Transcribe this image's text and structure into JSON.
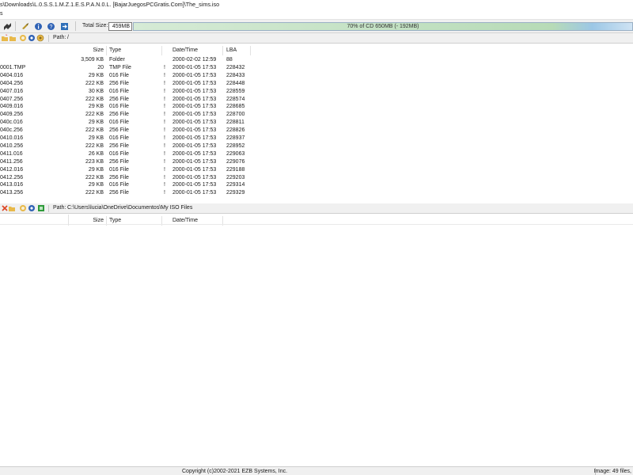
{
  "window": {
    "title": "s\\Downloads\\L.0.S.S.1.M.Z.1.E.S.P.A.N.0.L. [BajarJuegosPCGratis.Com]\\The_sims.iso"
  },
  "menu": {
    "label": "s"
  },
  "toolbar": {
    "total_size_label": "Total Size:",
    "total_size_value": "459MB",
    "capacity_text": "70% of CD 650MB (- 192MB)",
    "capacity_fraction": 0.7,
    "icons": [
      "properties-icon",
      "add-icon",
      "info-icon",
      "help-icon",
      "exit-icon"
    ]
  },
  "iso_pane": {
    "path_label": "Path:",
    "path_value": "/",
    "columns": {
      "size": "Size",
      "type": "Type",
      "date": "Date/Time",
      "lba": "LBA"
    },
    "rows": [
      {
        "name": "",
        "size": "3,509 KB",
        "type": "Folder",
        "flag": "",
        "date": "2000-02-02 12:59",
        "lba": "88"
      },
      {
        "name": "0001.TMP",
        "size": "20",
        "type": "TMP File",
        "flag": "!",
        "date": "2000-01-05 17:53",
        "lba": "228432"
      },
      {
        "name": "0404.016",
        "size": "29 KB",
        "type": "016 File",
        "flag": "!",
        "date": "2000-01-05 17:53",
        "lba": "228433"
      },
      {
        "name": "0404.256",
        "size": "222 KB",
        "type": "256 File",
        "flag": "!",
        "date": "2000-01-05 17:53",
        "lba": "228448"
      },
      {
        "name": "0407.016",
        "size": "30 KB",
        "type": "016 File",
        "flag": "!",
        "date": "2000-01-05 17:53",
        "lba": "228559"
      },
      {
        "name": "0407.256",
        "size": "222 KB",
        "type": "256 File",
        "flag": "!",
        "date": "2000-01-05 17:53",
        "lba": "228574"
      },
      {
        "name": "0409.016",
        "size": "29 KB",
        "type": "016 File",
        "flag": "!",
        "date": "2000-01-05 17:53",
        "lba": "228685"
      },
      {
        "name": "0409.256",
        "size": "222 KB",
        "type": "256 File",
        "flag": "!",
        "date": "2000-01-05 17:53",
        "lba": "228700"
      },
      {
        "name": "040c.016",
        "size": "29 KB",
        "type": "016 File",
        "flag": "!",
        "date": "2000-01-05 17:53",
        "lba": "228811"
      },
      {
        "name": "040c.256",
        "size": "222 KB",
        "type": "256 File",
        "flag": "!",
        "date": "2000-01-05 17:53",
        "lba": "228826"
      },
      {
        "name": "0410.016",
        "size": "29 KB",
        "type": "016 File",
        "flag": "!",
        "date": "2000-01-05 17:53",
        "lba": "228937"
      },
      {
        "name": "0410.256",
        "size": "222 KB",
        "type": "256 File",
        "flag": "!",
        "date": "2000-01-05 17:53",
        "lba": "228952"
      },
      {
        "name": "0411.016",
        "size": "26 KB",
        "type": "016 File",
        "flag": "!",
        "date": "2000-01-05 17:53",
        "lba": "229063"
      },
      {
        "name": "0411.256",
        "size": "223 KB",
        "type": "256 File",
        "flag": "!",
        "date": "2000-01-05 17:53",
        "lba": "229076"
      },
      {
        "name": "0412.016",
        "size": "29 KB",
        "type": "016 File",
        "flag": "!",
        "date": "2000-01-05 17:53",
        "lba": "229188"
      },
      {
        "name": "0412.256",
        "size": "222 KB",
        "type": "256 File",
        "flag": "!",
        "date": "2000-01-05 17:53",
        "lba": "229203"
      },
      {
        "name": "0413.016",
        "size": "29 KB",
        "type": "016 File",
        "flag": "!",
        "date": "2000-01-05 17:53",
        "lba": "229314"
      },
      {
        "name": "0413.256",
        "size": "222 KB",
        "type": "256 File",
        "flag": "!",
        "date": "2000-01-05 17:53",
        "lba": "229329"
      }
    ]
  },
  "local_pane": {
    "path_label": "Path:",
    "path_value": "C:\\Users\\lucia\\OneDrive\\Documentos\\My ISO Files",
    "columns": {
      "size": "Size",
      "type": "Type",
      "date": "Date/Time"
    }
  },
  "status": {
    "copyright": "Copyright (c)2002-2021 EZB Systems, Inc.",
    "image_info": "Image: 49 files,"
  }
}
